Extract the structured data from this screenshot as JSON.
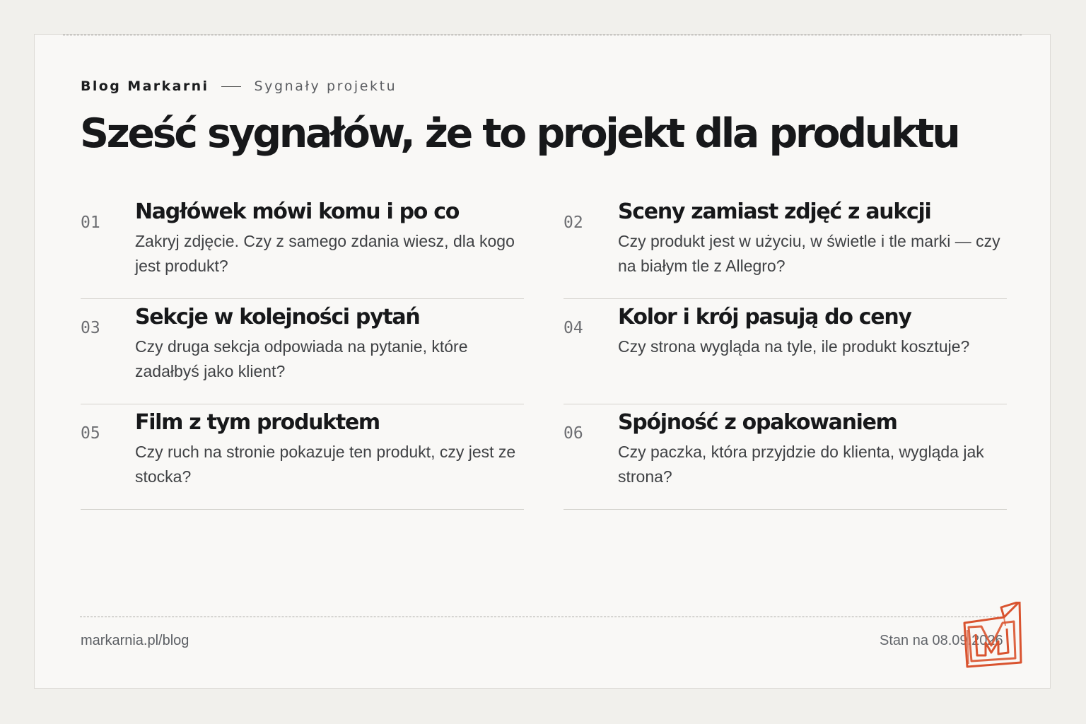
{
  "header": {
    "brand": "Blog Markarni",
    "section": "Sygnały projektu",
    "title": "Sześć sygnałów, że to projekt dla produktu"
  },
  "items": [
    {
      "num": "01",
      "title": "Nagłówek mówi komu i po co",
      "desc": "Zakryj zdjęcie. Czy z samego zdania wiesz, dla kogo jest produkt?"
    },
    {
      "num": "02",
      "title": "Sceny zamiast zdjęć z aukcji",
      "desc": "Czy produkt jest w użyciu, w świetle i tle marki — czy na białym tle z Allegro?"
    },
    {
      "num": "03",
      "title": "Sekcje w kolejności pytań",
      "desc": "Czy druga sekcja odpowiada na pytanie, które zadałbyś jako klient?"
    },
    {
      "num": "04",
      "title": "Kolor i krój pasują do ceny",
      "desc": "Czy strona wygląda na tyle, ile produkt kosztuje?"
    },
    {
      "num": "05",
      "title": "Film z tym produktem",
      "desc": "Czy ruch na stronie pokazuje ten produkt, czy jest ze stocka?"
    },
    {
      "num": "06",
      "title": "Spójność z opakowaniem",
      "desc": "Czy paczka, która przyjdzie do klienta, wygląda jak strona?"
    }
  ],
  "footer": {
    "url": "markarnia.pl/blog",
    "date": "Stan na 08.09.2026"
  },
  "logo": {
    "icon": "markarnia-m-logo",
    "color": "#d9532f"
  }
}
